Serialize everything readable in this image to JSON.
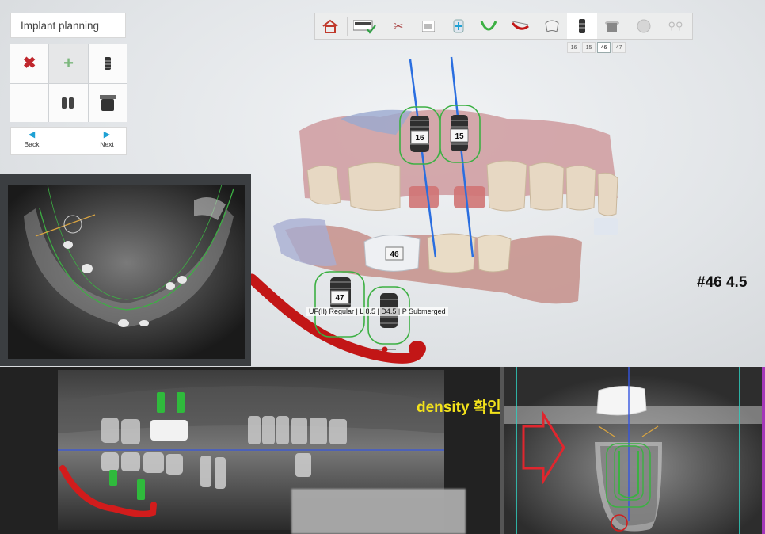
{
  "panel": {
    "title": "Implant planning",
    "back_label": "Back",
    "next_label": "Next"
  },
  "tooth_tabs": [
    "16",
    "15",
    "46",
    "47"
  ],
  "active_tab": "46",
  "implant_labels": [
    "16",
    "15",
    "46",
    "47"
  ],
  "implant_info": "UF(II) Regular | L 8.5 | D4.5 | P Submerged",
  "annotation_tooth": "#46 4.5",
  "annotation_density": "density 확인",
  "colors": {
    "accent_blue": "#1ea1d4",
    "implant_green": "#3cb043",
    "nerve_red": "#d21c1c",
    "annotation_yellow": "#f3e21b",
    "delete_red": "#c0272d"
  }
}
